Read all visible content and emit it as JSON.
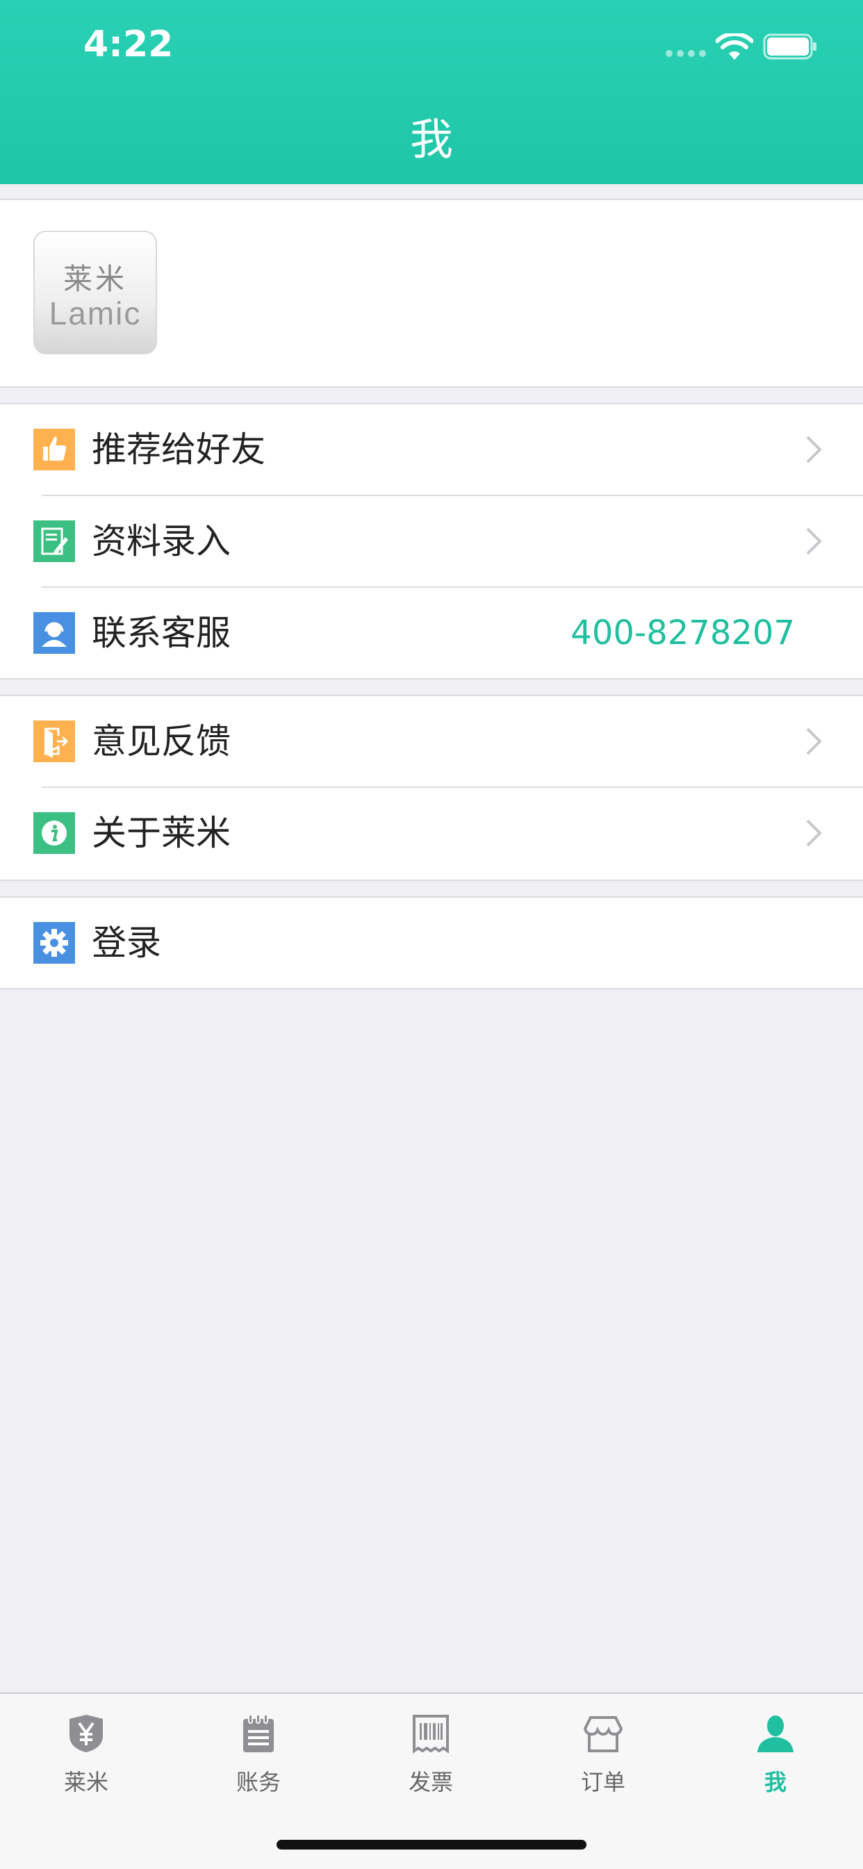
{
  "status_bar": {
    "time": "4:22"
  },
  "header": {
    "title": "我"
  },
  "profile": {
    "avatar_cn": "莱米",
    "avatar_en": "Lamic"
  },
  "groups": {
    "main": {
      "recommend": "推荐给好友",
      "data_entry": "资料录入",
      "contact_service": "联系客服",
      "phone": "400-8278207"
    },
    "more": {
      "feedback": "意见反馈",
      "about": "关于莱米"
    },
    "account": {
      "login": "登录"
    }
  },
  "tabs": [
    {
      "label": "莱米"
    },
    {
      "label": "账务"
    },
    {
      "label": "发票"
    },
    {
      "label": "订单"
    },
    {
      "label": "我"
    }
  ],
  "colors": {
    "brand_green": "#1fc5a7",
    "accent_teal": "#1fbf9f",
    "orange_icon": "#ffb14f",
    "green_icon": "#3cbf82",
    "blue_icon": "#4a90e2"
  }
}
